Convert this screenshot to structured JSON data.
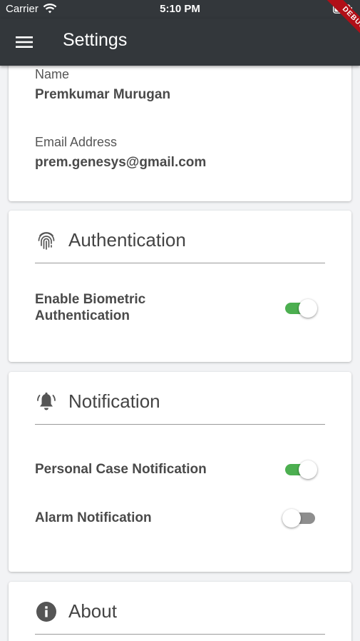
{
  "status_bar": {
    "carrier": "Carrier",
    "time": "5:10 PM"
  },
  "app_bar": {
    "title": "Settings",
    "debug_label": "DEBUG"
  },
  "profile": {
    "name_label": "Name",
    "name_value": "Premkumar Murugan",
    "email_label": "Email Address",
    "email_value": "prem.genesys@gmail.com"
  },
  "authentication": {
    "title": "Authentication",
    "icon": "fingerprint-icon",
    "settings": [
      {
        "label": "Enable Biometric Authentication",
        "enabled": true
      }
    ]
  },
  "notification": {
    "title": "Notification",
    "icon": "bell-icon",
    "settings": [
      {
        "label": "Personal Case Notification",
        "enabled": true
      },
      {
        "label": "Alarm Notification",
        "enabled": false
      }
    ]
  },
  "about": {
    "title": "About",
    "icon": "info-icon"
  },
  "colors": {
    "app_bar": "#33373b",
    "switch_on": "#4caf50",
    "switch_off": "#8e8e8e",
    "background": "#f2f3f5",
    "debug_ribbon": "#b00f17"
  }
}
